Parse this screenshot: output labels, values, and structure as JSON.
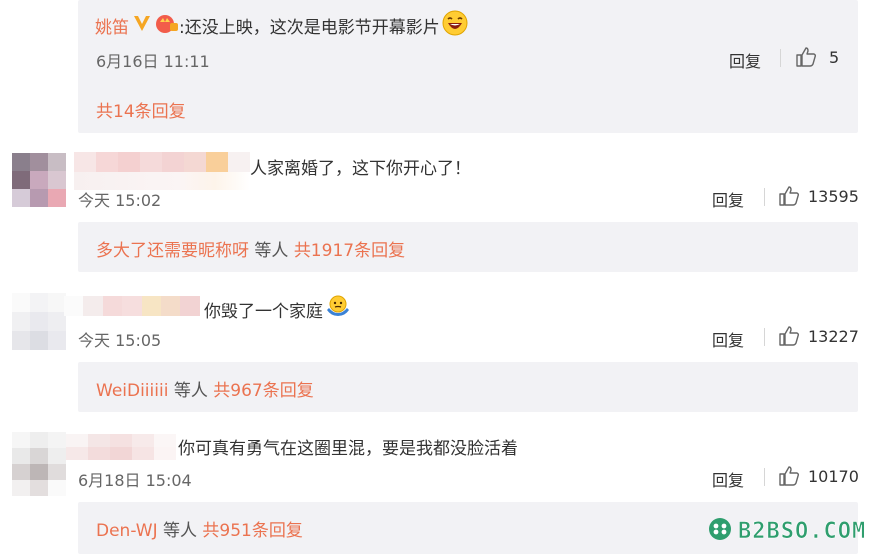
{
  "top_reply": {
    "name": "姚笛",
    "text": ":还没上映，这次是电影节开幕影片",
    "time": "6月16日 11:11",
    "reply_label": "回复",
    "likes": "5",
    "more": "共14条回复"
  },
  "comments": [
    {
      "text": "人家离婚了，这下你开心了！",
      "time": "今天 15:02",
      "reply_label": "回复",
      "likes": "13595",
      "repliers": "多大了还需要昵称呀",
      "etc": " 等人 ",
      "count": "共1917条回复"
    },
    {
      "text": "你毁了一个家庭",
      "time": "今天 15:05",
      "reply_label": "回复",
      "likes": "13227",
      "repliers": "WeiDiiiiii",
      "etc": " 等人 ",
      "count": "共967条回复"
    },
    {
      "text": "你可真有勇气在这圈里混，要是我都没脸活着",
      "time": "6月18日 15:04",
      "reply_label": "回复",
      "likes": "10170",
      "repliers": "Den-WJ",
      "etc": " 等人 ",
      "count": "共951条回复"
    }
  ],
  "watermark": "B2BSO.COM",
  "colors": {
    "accent": "#eb7350",
    "panel": "#f2f2f5",
    "watermark": "#2f9e6e"
  }
}
